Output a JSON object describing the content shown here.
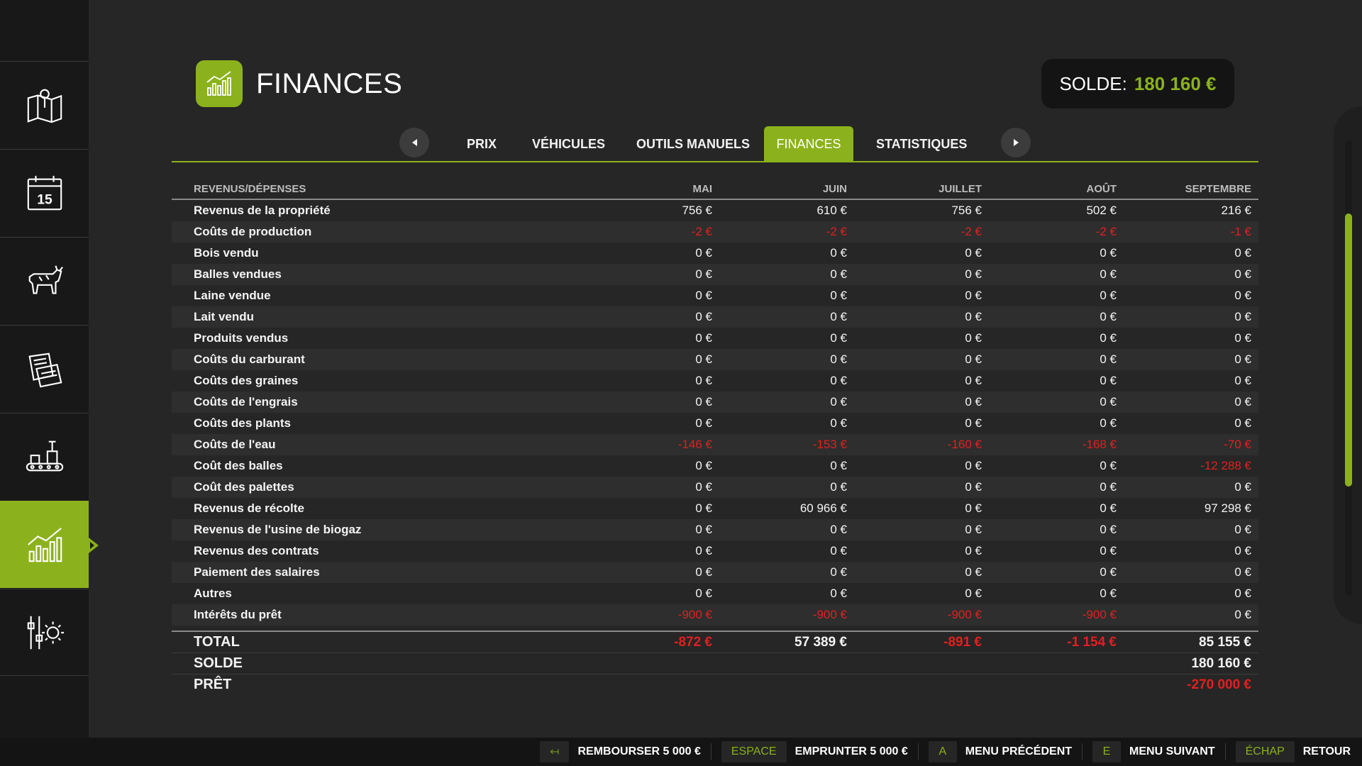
{
  "sidebar": {
    "items": [
      {
        "icon": "map-icon"
      },
      {
        "icon": "calendar-icon",
        "day": "15"
      },
      {
        "icon": "cow-icon"
      },
      {
        "icon": "contracts-icon"
      },
      {
        "icon": "production-icon"
      },
      {
        "icon": "finances-chart-icon",
        "active": true
      },
      {
        "icon": "settings-icon"
      }
    ]
  },
  "header": {
    "title": "FINANCES",
    "balance_label": "SOLDE:",
    "balance_value": "180 160 €"
  },
  "tabs": [
    {
      "label": "PRIX"
    },
    {
      "label": "VÉHICULES"
    },
    {
      "label": "OUTILS MANUELS"
    },
    {
      "label": "FINANCES",
      "active": true
    },
    {
      "label": "STATISTIQUES"
    }
  ],
  "table": {
    "header": [
      "REVENUS/DÉPENSES",
      "MAI",
      "JUIN",
      "JUILLET",
      "AOÛT",
      "SEPTEMBRE"
    ],
    "rows": [
      {
        "label": "Revenus de la propriété",
        "values": [
          "756 €",
          "610 €",
          "756 €",
          "502 €",
          "216 €"
        ]
      },
      {
        "label": "Coûts de production",
        "values": [
          "-2 €",
          "-2 €",
          "-2 €",
          "-2 €",
          "-1 €"
        ]
      },
      {
        "label": "Bois vendu",
        "values": [
          "0 €",
          "0 €",
          "0 €",
          "0 €",
          "0 €"
        ]
      },
      {
        "label": "Balles vendues",
        "values": [
          "0 €",
          "0 €",
          "0 €",
          "0 €",
          "0 €"
        ]
      },
      {
        "label": "Laine vendue",
        "values": [
          "0 €",
          "0 €",
          "0 €",
          "0 €",
          "0 €"
        ]
      },
      {
        "label": "Lait vendu",
        "values": [
          "0 €",
          "0 €",
          "0 €",
          "0 €",
          "0 €"
        ]
      },
      {
        "label": "Produits vendus",
        "values": [
          "0 €",
          "0 €",
          "0 €",
          "0 €",
          "0 €"
        ]
      },
      {
        "label": "Coûts du carburant",
        "values": [
          "0 €",
          "0 €",
          "0 €",
          "0 €",
          "0 €"
        ]
      },
      {
        "label": "Coûts des graines",
        "values": [
          "0 €",
          "0 €",
          "0 €",
          "0 €",
          "0 €"
        ]
      },
      {
        "label": "Coûts de l'engrais",
        "values": [
          "0 €",
          "0 €",
          "0 €",
          "0 €",
          "0 €"
        ]
      },
      {
        "label": "Coûts des plants",
        "values": [
          "0 €",
          "0 €",
          "0 €",
          "0 €",
          "0 €"
        ]
      },
      {
        "label": "Coûts de l'eau",
        "values": [
          "-146 €",
          "-153 €",
          "-160 €",
          "-168 €",
          "-70 €"
        ]
      },
      {
        "label": "Coût des balles",
        "values": [
          "0 €",
          "0 €",
          "0 €",
          "0 €",
          "-12 288 €"
        ]
      },
      {
        "label": "Coût des palettes",
        "values": [
          "0 €",
          "0 €",
          "0 €",
          "0 €",
          "0 €"
        ]
      },
      {
        "label": "Revenus de récolte",
        "values": [
          "0 €",
          "60 966 €",
          "0 €",
          "0 €",
          "97 298 €"
        ]
      },
      {
        "label": "Revenus de l'usine de biogaz",
        "values": [
          "0 €",
          "0 €",
          "0 €",
          "0 €",
          "0 €"
        ]
      },
      {
        "label": "Revenus des contrats",
        "values": [
          "0 €",
          "0 €",
          "0 €",
          "0 €",
          "0 €"
        ]
      },
      {
        "label": "Paiement des salaires",
        "values": [
          "0 €",
          "0 €",
          "0 €",
          "0 €",
          "0 €"
        ]
      },
      {
        "label": "Autres",
        "values": [
          "0 €",
          "0 €",
          "0 €",
          "0 €",
          "0 €"
        ]
      },
      {
        "label": "Intérêts du prêt",
        "values": [
          "-900 €",
          "-900 €",
          "-900 €",
          "-900 €",
          "0 €"
        ]
      }
    ],
    "summary": [
      {
        "label": "TOTAL",
        "values": [
          "-872 €",
          "57 389 €",
          "-891 €",
          "-1 154 €",
          "85 155 €"
        ]
      },
      {
        "label": "SOLDE",
        "values": [
          "",
          "",
          "",
          "",
          "180 160 €"
        ]
      },
      {
        "label": "PRÊT",
        "values": [
          "",
          "",
          "",
          "",
          "-270 000 €"
        ]
      }
    ]
  },
  "scroll": {
    "position": 0.4
  },
  "footer": {
    "hints": [
      {
        "key": "↤",
        "label": "REMBOURSER 5 000 €"
      },
      {
        "key": "ESPACE",
        "label": "EMPRUNTER 5 000 €"
      },
      {
        "key": "A",
        "label": "MENU PRÉCÉDENT"
      },
      {
        "key": "E",
        "label": "MENU SUIVANT"
      },
      {
        "key": "ÉCHAP",
        "label": "RETOUR"
      }
    ]
  },
  "colors": {
    "accent": "#8bb21c",
    "negative": "#e02020",
    "background": "#262626",
    "sidebar": "#181818"
  }
}
